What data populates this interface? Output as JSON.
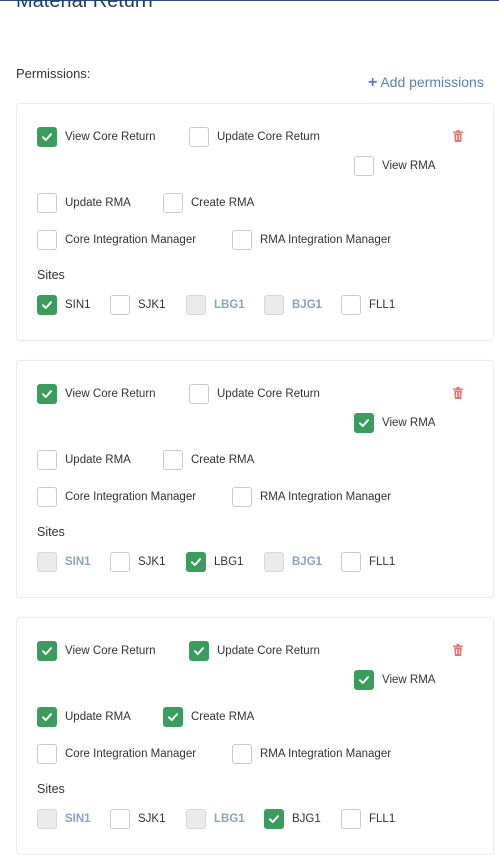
{
  "page": {
    "title": "Material Return"
  },
  "permissions_label": "Permissions:",
  "add_permissions_label": "Add permissions",
  "sites_label": "Sites",
  "colors": {
    "checked": "#3a9d5d",
    "accent": "#5b7fb5",
    "title": "#1f3f6b",
    "trash": "#e57373"
  },
  "cards": [
    {
      "perms": [
        {
          "label": "View Core Return",
          "checked": true
        },
        {
          "label": "Update Core Return",
          "checked": false
        },
        {
          "label": "View RMA",
          "checked": false
        },
        {
          "label": "Update RMA",
          "checked": false
        },
        {
          "label": "Create RMA",
          "checked": false
        },
        {
          "label": "Core Integration Manager",
          "checked": false
        },
        {
          "label": "RMA Integration Manager",
          "checked": false
        }
      ],
      "sites": [
        {
          "label": "SIN1",
          "checked": true,
          "disabled": false
        },
        {
          "label": "SJK1",
          "checked": false,
          "disabled": false
        },
        {
          "label": "LBG1",
          "checked": false,
          "disabled": true
        },
        {
          "label": "BJG1",
          "checked": false,
          "disabled": true
        },
        {
          "label": "FLL1",
          "checked": false,
          "disabled": false
        }
      ]
    },
    {
      "perms": [
        {
          "label": "View Core Return",
          "checked": true
        },
        {
          "label": "Update Core Return",
          "checked": false
        },
        {
          "label": "View RMA",
          "checked": true
        },
        {
          "label": "Update RMA",
          "checked": false
        },
        {
          "label": "Create RMA",
          "checked": false
        },
        {
          "label": "Core Integration Manager",
          "checked": false
        },
        {
          "label": "RMA Integration Manager",
          "checked": false
        }
      ],
      "sites": [
        {
          "label": "SIN1",
          "checked": false,
          "disabled": true
        },
        {
          "label": "SJK1",
          "checked": false,
          "disabled": false
        },
        {
          "label": "LBG1",
          "checked": true,
          "disabled": false
        },
        {
          "label": "BJG1",
          "checked": false,
          "disabled": true
        },
        {
          "label": "FLL1",
          "checked": false,
          "disabled": false
        }
      ]
    },
    {
      "perms": [
        {
          "label": "View Core Return",
          "checked": true
        },
        {
          "label": "Update Core Return",
          "checked": true
        },
        {
          "label": "View RMA",
          "checked": true
        },
        {
          "label": "Update RMA",
          "checked": true
        },
        {
          "label": "Create RMA",
          "checked": true
        },
        {
          "label": "Core Integration Manager",
          "checked": false
        },
        {
          "label": "RMA Integration Manager",
          "checked": false
        }
      ],
      "sites": [
        {
          "label": "SIN1",
          "checked": false,
          "disabled": true
        },
        {
          "label": "SJK1",
          "checked": false,
          "disabled": false
        },
        {
          "label": "LBG1",
          "checked": false,
          "disabled": true
        },
        {
          "label": "BJG1",
          "checked": true,
          "disabled": false
        },
        {
          "label": "FLL1",
          "checked": false,
          "disabled": false
        }
      ]
    }
  ]
}
